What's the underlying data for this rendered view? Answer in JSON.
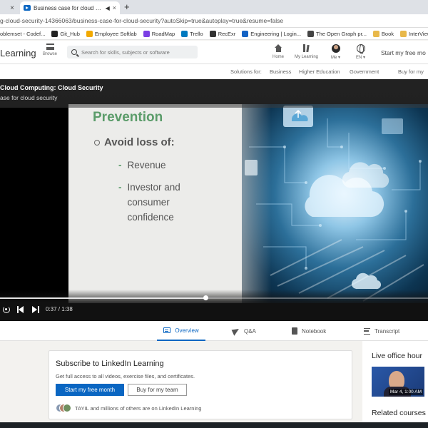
{
  "browser": {
    "prev_tab_close": "×",
    "active_tab_title": "Business case for cloud sec...",
    "new_tab": "+",
    "url": "g-cloud-security-14366063/business-case-for-cloud-security?autoSkip=true&autoplay=true&resume=false",
    "bookmarks": [
      {
        "label": "oblemset - Codef...",
        "color": "#1f8acb"
      },
      {
        "label": "Git_Hub",
        "color": "#222222"
      },
      {
        "label": "Employee Softlab",
        "color": "#f2a900"
      },
      {
        "label": "RoadMap",
        "color": "#7b3fe4"
      },
      {
        "label": "Trello",
        "color": "#0079bf"
      },
      {
        "label": "RecExr",
        "color": "#333333"
      },
      {
        "label": "Engineering | Login...",
        "color": "#1463c4"
      },
      {
        "label": "The Open Graph pr...",
        "color": "#444444"
      },
      {
        "label": "Book",
        "color": "#e8b84a"
      },
      {
        "label": "InterViewQuestion",
        "color": "#e8b84a"
      }
    ]
  },
  "header": {
    "logo_text": "Learning",
    "browse_label": "Browse",
    "search_placeholder": "Search for skills, subjects or software",
    "nav": {
      "home": "Home",
      "my_learning": "My Learning",
      "me": "Me ▾",
      "language": "EN ▾"
    },
    "start_free": "Start my free mo"
  },
  "subnav": {
    "solutions_for": "Solutions for:",
    "business": "Business",
    "higher_education": "Higher Education",
    "government": "Government",
    "buy_for_team": "Buy for my"
  },
  "player": {
    "course_title": "Cloud Computing: Cloud Security",
    "video_title": "ase for cloud security",
    "slide": {
      "heading": "Prevention",
      "bullet": "Avoid loss of:",
      "sub_bullets": [
        "Revenue",
        "Investor and consumer confidence"
      ],
      "dash": "-"
    },
    "progress": 0.48,
    "timecode": "0:37 / 1:38"
  },
  "tabs": {
    "overview": "Overview",
    "qa": "Q&A",
    "notebook": "Notebook",
    "transcript": "Transcript"
  },
  "subscribe": {
    "title": "Subscribe to LinkedIn Learning",
    "description": "Get full access to all videos, exercise files, and certificates.",
    "primary_button": "Start my free month",
    "secondary_button": "Buy for my team",
    "members_text": "TAYIL and millions of others are on LinkedIn Learning"
  },
  "sidebar": {
    "live_title": "Live office hour",
    "event_date": "Mar 4, 1:00 AM",
    "related_title": "Related courses"
  }
}
